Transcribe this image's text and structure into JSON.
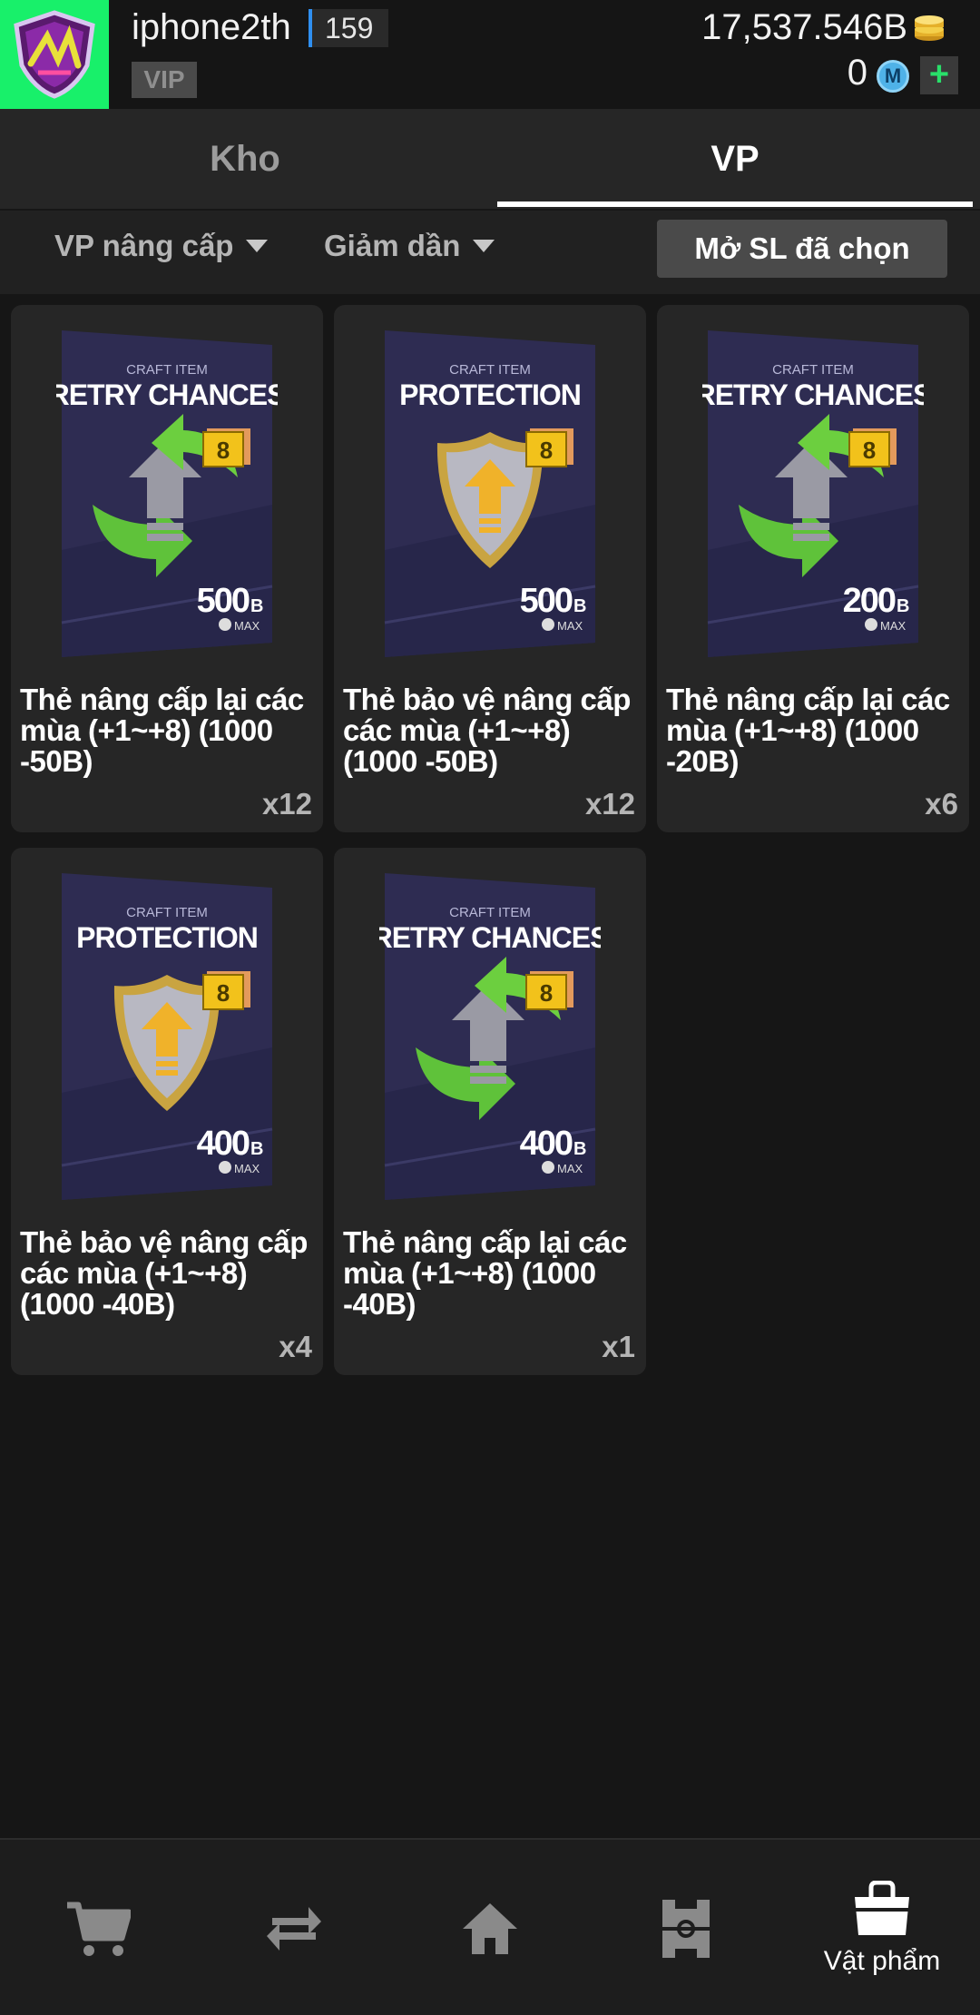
{
  "header": {
    "username": "iphone2th",
    "level": "159",
    "vip_label": "VIP",
    "coins": "17,537.546B",
    "m_count": "0",
    "m_icon_letter": "M",
    "plus_label": "+"
  },
  "tabs": [
    {
      "label": "Kho",
      "active": false
    },
    {
      "label": "VP",
      "active": true
    }
  ],
  "filters": {
    "category": "VP nâng cấp",
    "sort": "Giảm dần",
    "open_selected": "Mở SL đã chọn"
  },
  "items": [
    {
      "card_sub": "CRAFT ITEM",
      "card_type": "RETRY CHANCES",
      "badge": "8",
      "amount": "500",
      "unit": "B",
      "max": "MAX",
      "title": "Thẻ nâng cấp lại các mùa (+1~+8) (1000 -50B)",
      "qty": "x12"
    },
    {
      "card_sub": "CRAFT ITEM",
      "card_type": "PROTECTION",
      "badge": "8",
      "amount": "500",
      "unit": "B",
      "max": "MAX",
      "title": "Thẻ bảo vệ nâng cấp các mùa (+1~+8) (1000 -50B)",
      "qty": "x12"
    },
    {
      "card_sub": "CRAFT ITEM",
      "card_type": "RETRY CHANCES",
      "badge": "8",
      "amount": "200",
      "unit": "B",
      "max": "MAX",
      "title": "Thẻ nâng cấp lại các mùa (+1~+8) (1000 -20B)",
      "qty": "x6"
    },
    {
      "card_sub": "CRAFT ITEM",
      "card_type": "PROTECTION",
      "badge": "8",
      "amount": "400",
      "unit": "B",
      "max": "MAX",
      "title": "Thẻ bảo vệ nâng cấp các mùa (+1~+8) (1000 -40B)",
      "qty": "x4"
    },
    {
      "card_sub": "CRAFT ITEM",
      "card_type": "RETRY CHANCES",
      "badge": "8",
      "amount": "400",
      "unit": "B",
      "max": "MAX",
      "title": "Thẻ nâng cấp lại các mùa (+1~+8) (1000 -40B)",
      "qty": "x1"
    }
  ],
  "bottom_nav": [
    {
      "icon": "cart-icon",
      "label": ""
    },
    {
      "icon": "transfer-icon",
      "label": ""
    },
    {
      "icon": "home-icon",
      "label": ""
    },
    {
      "icon": "squad-field-icon",
      "label": ""
    },
    {
      "icon": "bag-icon",
      "label": "Vật phẩm",
      "active": true
    }
  ],
  "colors": {
    "avatar_bg": "#18f06a",
    "level_accent": "#2f8ff0",
    "card_bg": "#2e2c52",
    "badge_gold": "#f2c21b",
    "arrow_green": "#5fc23a"
  }
}
